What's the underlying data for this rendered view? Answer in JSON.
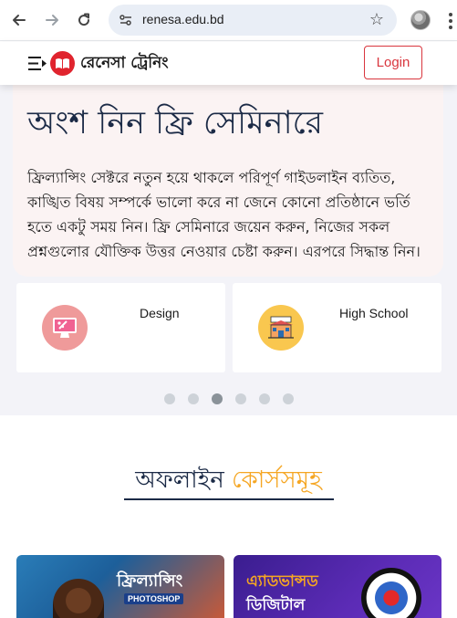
{
  "browser": {
    "url": "renesa.edu.bd",
    "icons": [
      "back-icon",
      "forward-icon",
      "reload-icon",
      "site-info-icon",
      "bookmark-star-icon",
      "profile-avatar",
      "menu-kebab-icon"
    ]
  },
  "header": {
    "brand_name": "রেনেসা ট্রেনিং",
    "login_label": "Login",
    "accent_color": "#d9363e"
  },
  "hero": {
    "title": "অংশ নিন ফ্রি সেমিনারে",
    "text": "ফ্রিল্যান্সিং সেক্টরে নতুন হয়ে থাকলে পরিপূর্ণ গাইডলাইন ব্যতিত, কাঙ্খিত বিষয় সম্পর্কে ভালো করে না জেনে কোনো প্রতিষ্ঠানে ভর্তি হতে একটু সময় নিন। ফ্রি সেমিনারে জয়েন করুন, নিজের সকল প্রশ্নগুলোর যৌক্তিক উত্তর নেওয়ার চেষ্টা করুন। এরপরে সিদ্ধান্ত নিন।"
  },
  "categories": [
    {
      "label": "Design",
      "icon": "design-monitor-icon"
    },
    {
      "label": "High School",
      "icon": "school-building-icon"
    }
  ],
  "carousel": {
    "dot_count": 6,
    "active_index": 2
  },
  "offline_courses": {
    "title_part1": "অফলাইন",
    "title_part2": "কোর্সসমূহ",
    "cards": [
      {
        "title": "ফ্রিল্যান্সিং",
        "subtitle": "PHOTOSHOP"
      },
      {
        "title": "এ্যাডভান্সড",
        "subtitle": "ডিজিটাল"
      }
    ]
  }
}
